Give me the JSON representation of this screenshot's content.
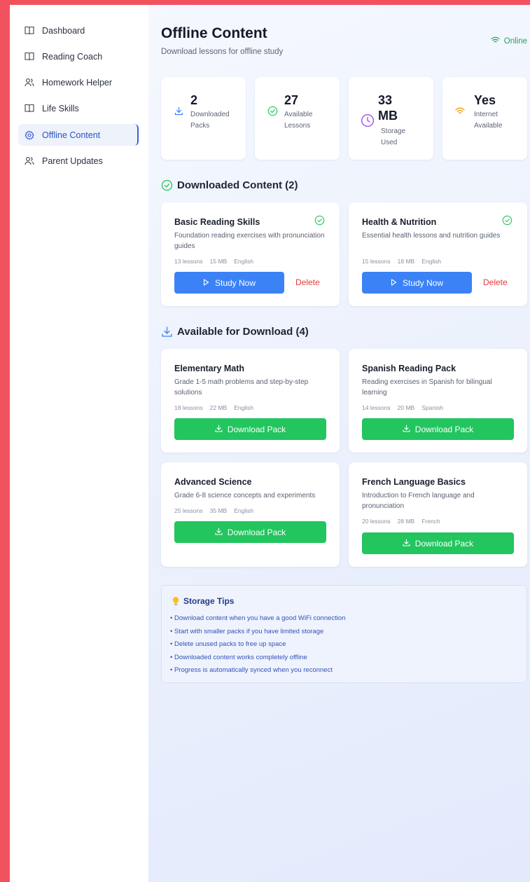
{
  "sidebar": {
    "items": [
      {
        "label": "Dashboard",
        "icon": "book-icon",
        "active": false
      },
      {
        "label": "Reading Coach",
        "icon": "book-icon",
        "active": false
      },
      {
        "label": "Homework Helper",
        "icon": "users-icon",
        "active": false
      },
      {
        "label": "Life Skills",
        "icon": "book-icon",
        "active": false
      },
      {
        "label": "Offline Content",
        "icon": "gear-icon",
        "active": true
      },
      {
        "label": "Parent Updates",
        "icon": "users-icon",
        "active": false
      }
    ]
  },
  "header": {
    "title": "Offline Content",
    "subtitle": "Download lessons for offline study",
    "status": "Online"
  },
  "stats": [
    {
      "value": "2",
      "label": "Downloaded Packs",
      "icon": "download-icon"
    },
    {
      "value": "27",
      "label": "Available Lessons",
      "icon": "check-circle-icon"
    },
    {
      "value": "33 MB",
      "label": "Storage Used",
      "icon": "clock-icon"
    },
    {
      "value": "Yes",
      "label": "Internet Available",
      "icon": "wifi-icon"
    }
  ],
  "downloaded": {
    "heading": "Downloaded Content (2)",
    "items": [
      {
        "title": "Basic Reading Skills",
        "description": "Foundation reading exercises with pronunciation guides",
        "lessons": "13 lessons",
        "size": "15 MB",
        "language": "English",
        "action": "Study Now",
        "delete": "Delete"
      },
      {
        "title": "Health & Nutrition",
        "description": "Essential health lessons and nutrition guides",
        "lessons": "15 lessons",
        "size": "18 MB",
        "language": "English",
        "action": "Study Now",
        "delete": "Delete"
      }
    ]
  },
  "available": {
    "heading": "Available for Download (4)",
    "items": [
      {
        "title": "Elementary Math",
        "description": "Grade 1-5 math problems and step-by-step solutions",
        "lessons": "18 lessons",
        "size": "22 MB",
        "language": "English",
        "action": "Download Pack"
      },
      {
        "title": "Spanish Reading Pack",
        "description": "Reading exercises in Spanish for bilingual learning",
        "lessons": "14 lessons",
        "size": "20 MB",
        "language": "Spanish",
        "action": "Download Pack"
      },
      {
        "title": "Advanced Science",
        "description": "Grade 6-8 science concepts and experiments",
        "lessons": "25 lessons",
        "size": "35 MB",
        "language": "English",
        "action": "Download Pack"
      },
      {
        "title": "French Language Basics",
        "description": "Introduction to French language and pronunciation",
        "lessons": "20 lessons",
        "size": "28 MB",
        "language": "French",
        "action": "Download Pack"
      }
    ]
  },
  "tips": {
    "heading": "Storage Tips",
    "items": [
      "• Download content when you have a good WiFi connection",
      "• Start with smaller packs if you have limited storage",
      "• Delete unused packs to free up space",
      "• Downloaded content works completely offline",
      "• Progress is automatically synced when you reconnect"
    ]
  },
  "colors": {
    "accent": "#3b82f6",
    "download": "#22c55e",
    "delete": "#e23b3b",
    "online": "#22a35a",
    "border": "#f2515e"
  }
}
